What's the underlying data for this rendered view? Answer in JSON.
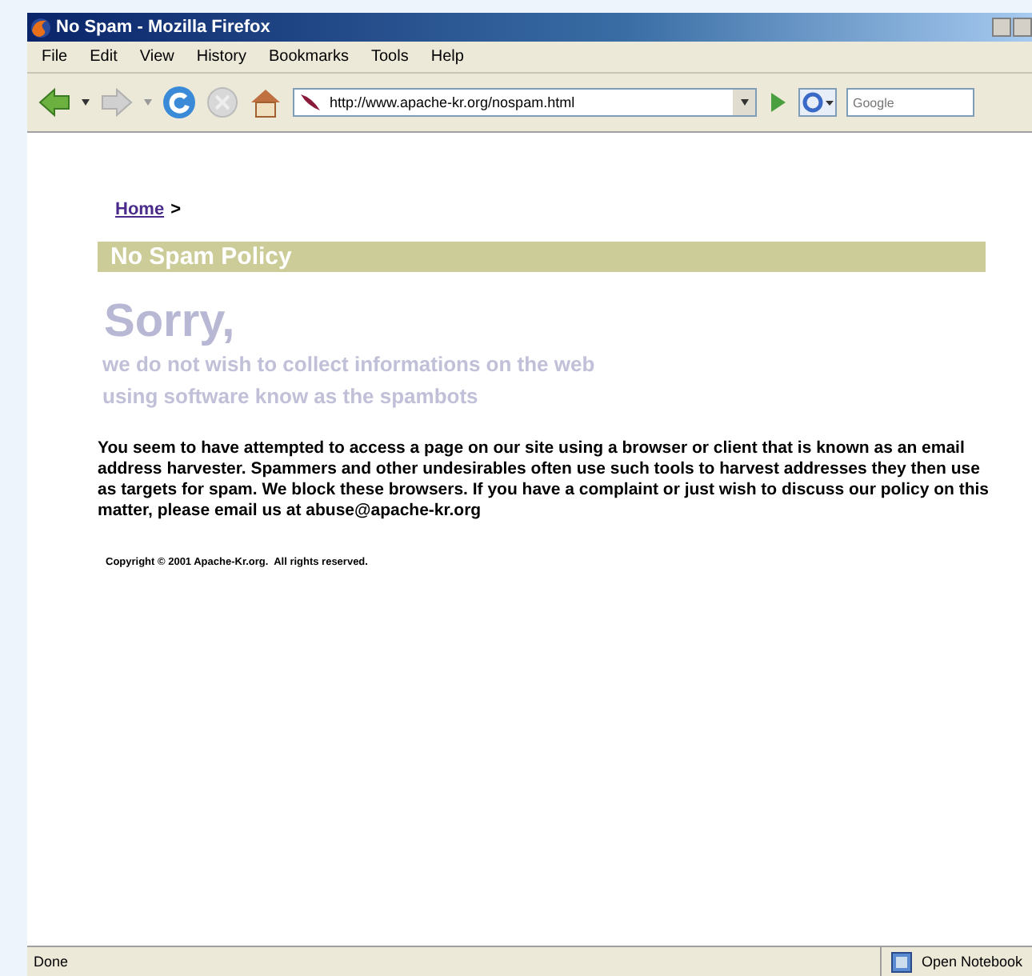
{
  "window": {
    "title": "No Spam - Mozilla Firefox"
  },
  "menu": [
    "File",
    "Edit",
    "View",
    "History",
    "Bookmarks",
    "Tools",
    "Help"
  ],
  "toolbar": {
    "url": "http://www.apache-kr.org/nospam.html",
    "search_placeholder": "Google"
  },
  "page": {
    "breadcrumb": {
      "link": "Home",
      "separator": ">"
    },
    "heading": "No Spam Policy",
    "title": "Sorry,",
    "subtitle": [
      "we do not wish to collect informations on the web",
      "using software know as the spambots"
    ],
    "message": "You seem to have attempted to access a page on our site using a browser or client that is known as an email address harvester. Spammers and other undesirables often use such tools to harvest addresses they then use as targets for spam. We block these browsers. If you have a complaint or just wish to discuss our policy on this matter, please email us at abuse@apache-kr.org",
    "copyright": "Copyright © 2001 Apache-Kr.org.  All rights reserved."
  },
  "status_bar": {
    "text": "Done",
    "notebook": "Open Notebook"
  }
}
